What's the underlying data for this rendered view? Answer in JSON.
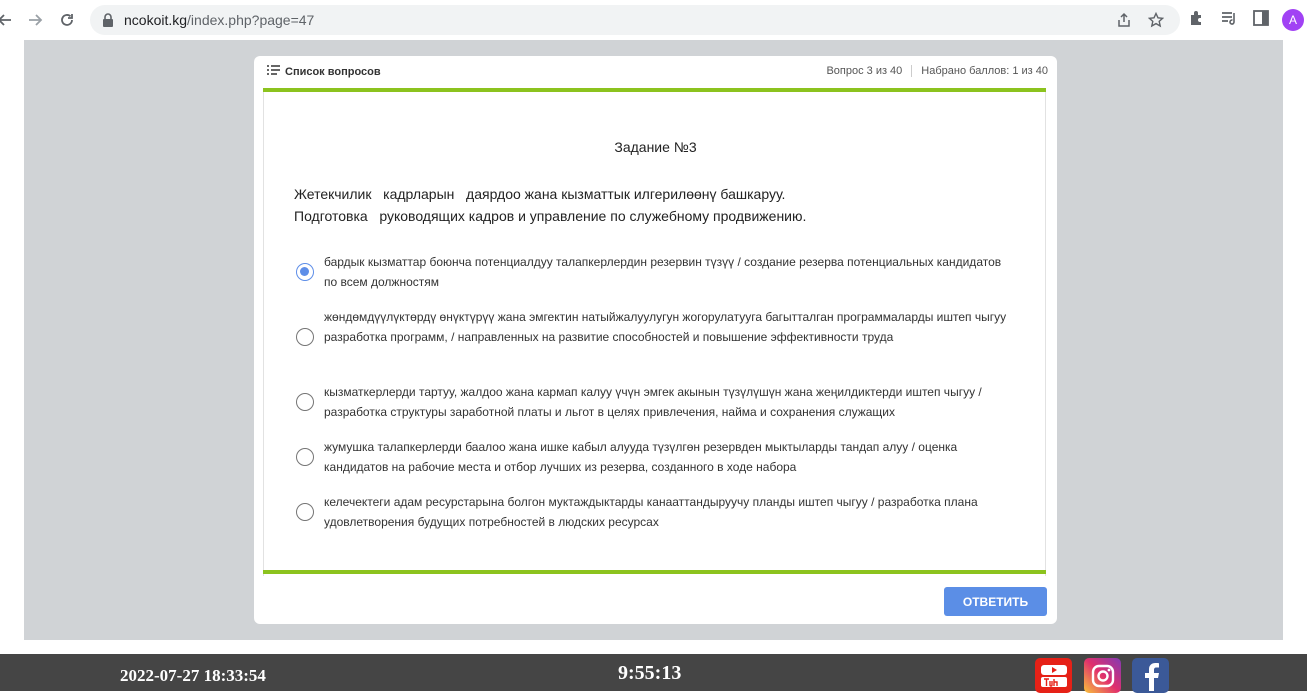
{
  "browser": {
    "url_host": "ncokoit.kg",
    "url_path": "/index.php?page=47",
    "profile_initial": "A"
  },
  "header": {
    "list_label": "Список вопросов",
    "question_counter": "Вопрос 3 из 40",
    "score": "Набрано баллов: 1 из 40"
  },
  "question": {
    "title": "Задание №3",
    "text": "Жетекчилик   кадрларын   даярдоо жана кызматтык илгерилөөнү башкаруу.\nПодготовка   руководящих кадров и управление по служебному продвижению.",
    "options": [
      {
        "text": "бардык кызматтар боюнча потенциалдуу талапкерлердин резервин түзүү /  создание резерва потенциальных кандидатов по всем должностям",
        "selected": true
      },
      {
        "text": "жөндөмдүүлүктөрдү өнүктүрүү жана эмгектин натыйжалуулугун жогорулатууга багытталган программаларды иштеп чыгуу  разработка программ, / направленных на развитие способностей и повышение эффективности труда",
        "selected": false
      },
      {
        "text": "кызматкерлерди тартуу, жалдоо жана кармап калуу үчүн эмгек акынын түзүлүшүн жана жеңилдиктерди иштеп чыгуу /  разработка структуры заработной платы и льгот в целях привлечения, найма и сохранения служащих",
        "selected": false
      },
      {
        "text": "жумушка талапкерлерди баалоо жана ишке кабыл алууда түзүлгөн резервден мыктыларды тандап алуу / оценка кандидатов на рабочие места и отбор лучших из резерва, созданного в ходе набора",
        "selected": false
      },
      {
        "text": "келечектеги адам ресурстарына болгон муктаждыктарды  канааттандыруучу планды иштеп чыгуу /  разработка плана удовлетворения будущих потребностей в людских ресурсах",
        "selected": false
      }
    ],
    "answer_button": "ОТВЕТИТЬ"
  },
  "footer": {
    "datetime": "2022-07-27 18:33:54",
    "timer": "9:55:13"
  },
  "colors": {
    "accent_green": "#8cc31e",
    "button_blue": "#5b8ee6",
    "footer_bg": "#454545"
  }
}
